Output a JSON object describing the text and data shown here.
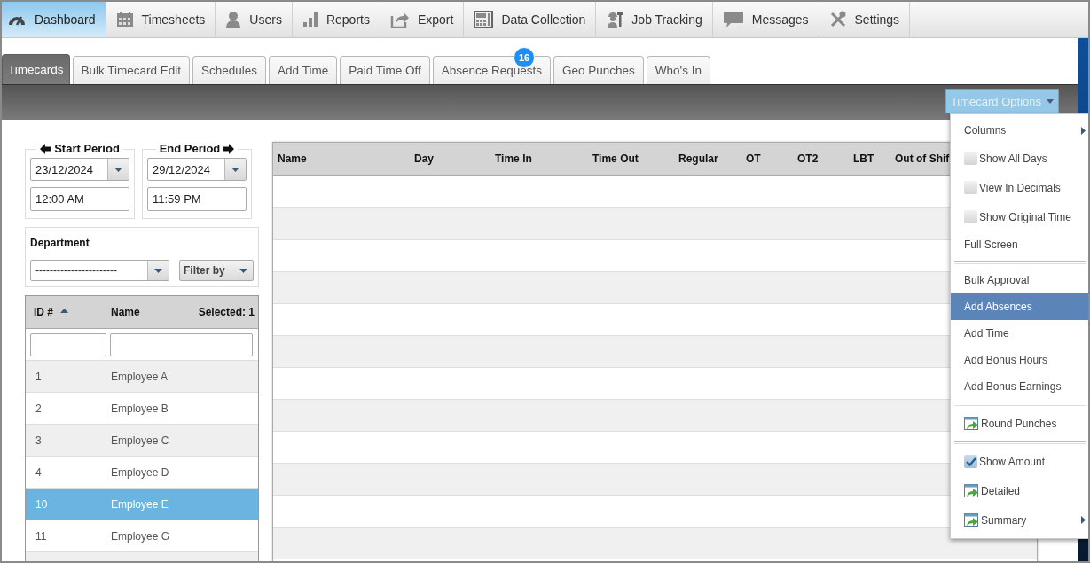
{
  "nav": [
    {
      "label": "Dashboard",
      "selected": true
    },
    {
      "label": "Timesheets",
      "selected": false
    },
    {
      "label": "Users",
      "selected": false
    },
    {
      "label": "Reports",
      "selected": false
    },
    {
      "label": "Export",
      "selected": false
    },
    {
      "label": "Data Collection",
      "selected": false
    },
    {
      "label": "Job Tracking",
      "selected": false
    },
    {
      "label": "Messages",
      "selected": false
    },
    {
      "label": "Settings",
      "selected": false
    }
  ],
  "tabs": [
    {
      "label": "Timecards",
      "selected": true
    },
    {
      "label": "Bulk Timecard Edit",
      "selected": false
    },
    {
      "label": "Schedules",
      "selected": false
    },
    {
      "label": "Add Time",
      "selected": false
    },
    {
      "label": "Paid Time Off",
      "selected": false
    },
    {
      "label": "Absence Requests",
      "selected": false,
      "badge": "16"
    },
    {
      "label": "Geo Punches",
      "selected": false
    },
    {
      "label": "Who's In",
      "selected": false
    }
  ],
  "options_button": {
    "label": "Timecard Options"
  },
  "period": {
    "start": {
      "label": "Start Period",
      "date": "23/12/2024",
      "time": "12:00 AM"
    },
    "end": {
      "label": "End Period",
      "date": "29/12/2024",
      "time": "11:59 PM"
    }
  },
  "department": {
    "label": "Department",
    "value": "-----------------------",
    "filter_button": "Filter by"
  },
  "employees": {
    "columns": [
      "ID #",
      "Name"
    ],
    "selected_count": "Selected: 1",
    "rows": [
      {
        "id": "1",
        "name": "Employee A",
        "selected": false
      },
      {
        "id": "2",
        "name": "Employee B",
        "selected": false
      },
      {
        "id": "3",
        "name": "Employee C",
        "selected": false
      },
      {
        "id": "4",
        "name": "Employee D",
        "selected": false
      },
      {
        "id": "10",
        "name": "Employee E",
        "selected": true
      },
      {
        "id": "11",
        "name": "Employee G",
        "selected": false
      }
    ]
  },
  "timecard_table": {
    "columns": [
      "Name",
      "Day",
      "Time In",
      "Time Out",
      "Regular",
      "OT",
      "OT2",
      "LBT",
      "Out of Shif"
    ]
  },
  "menu": {
    "sections": [
      {
        "items": [
          {
            "kind": "action",
            "label": "Columns",
            "has_submenu": true,
            "selected": false
          },
          {
            "kind": "checkbox",
            "label": "Show All Days",
            "checked": false,
            "selected": false
          },
          {
            "kind": "checkbox",
            "label": "View In Decimals",
            "checked": false,
            "selected": false
          },
          {
            "kind": "checkbox",
            "label": "Show Original Time",
            "checked": false,
            "selected": false
          },
          {
            "kind": "action",
            "label": "Full Screen",
            "selected": false
          }
        ]
      },
      {
        "items": [
          {
            "kind": "action",
            "label": "Bulk Approval",
            "selected": false
          },
          {
            "kind": "action",
            "label": "Add Absences",
            "selected": true
          },
          {
            "kind": "action",
            "label": "Add Time",
            "selected": false
          },
          {
            "kind": "action",
            "label": "Add Bonus Hours",
            "selected": false
          },
          {
            "kind": "action",
            "label": "Add Bonus Earnings",
            "selected": false
          }
        ]
      },
      {
        "items": [
          {
            "kind": "report",
            "label": "Round Punches",
            "selected": false
          }
        ]
      },
      {
        "items": [
          {
            "kind": "checkbox",
            "label": "Show Amount",
            "checked": true,
            "selected": false
          },
          {
            "kind": "report",
            "label": "Detailed",
            "selected": false
          },
          {
            "kind": "report",
            "label": "Summary",
            "has_submenu": true,
            "selected": false
          }
        ]
      }
    ]
  }
}
